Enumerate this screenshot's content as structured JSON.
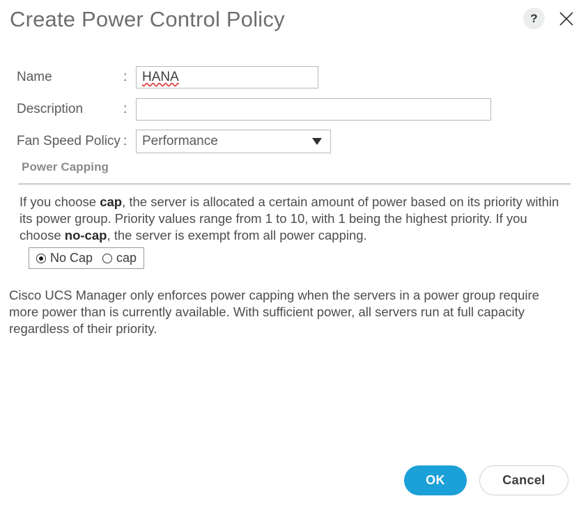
{
  "dialog": {
    "title": "Create Power Control Policy",
    "help_icon": "question-mark-icon",
    "close_icon": "close-x-icon"
  },
  "form": {
    "colon": ":",
    "fields": [
      {
        "label": "Name",
        "value": "HANA",
        "placeholder": ""
      },
      {
        "label": "Description",
        "value": "",
        "placeholder": ""
      },
      {
        "label": "Fan Speed Policy",
        "value": "Performance"
      }
    ],
    "fan_speed_options": [
      "Performance"
    ]
  },
  "section": {
    "heading": "Power Capping",
    "paragraph_cap": {
      "p1": "If you choose ",
      "b1": "cap",
      "p2": ", the server is allocated a certain amount of power based on its priority within its power group. Priority values range from 1 to 10, with 1 being the highest priority. If you choose ",
      "b2": "no-cap",
      "p3": ", the server is exempt from all power capping."
    },
    "radio": {
      "options": [
        {
          "label": "No Cap",
          "selected": true
        },
        {
          "label": "cap",
          "selected": false
        }
      ]
    },
    "paragraph_enforce": "Cisco UCS Manager only enforces power capping when the servers in a power group require more power than is currently available. With sufficient power, all servers run at full capacity regardless of their priority."
  },
  "footer": {
    "ok_label": "OK",
    "cancel_label": "Cancel"
  },
  "colors": {
    "accent_blue": "#1ba0d7",
    "title_gray": "#6e6e6e",
    "body_gray": "#4d4d4d",
    "border_gray": "#b9b9b9"
  }
}
